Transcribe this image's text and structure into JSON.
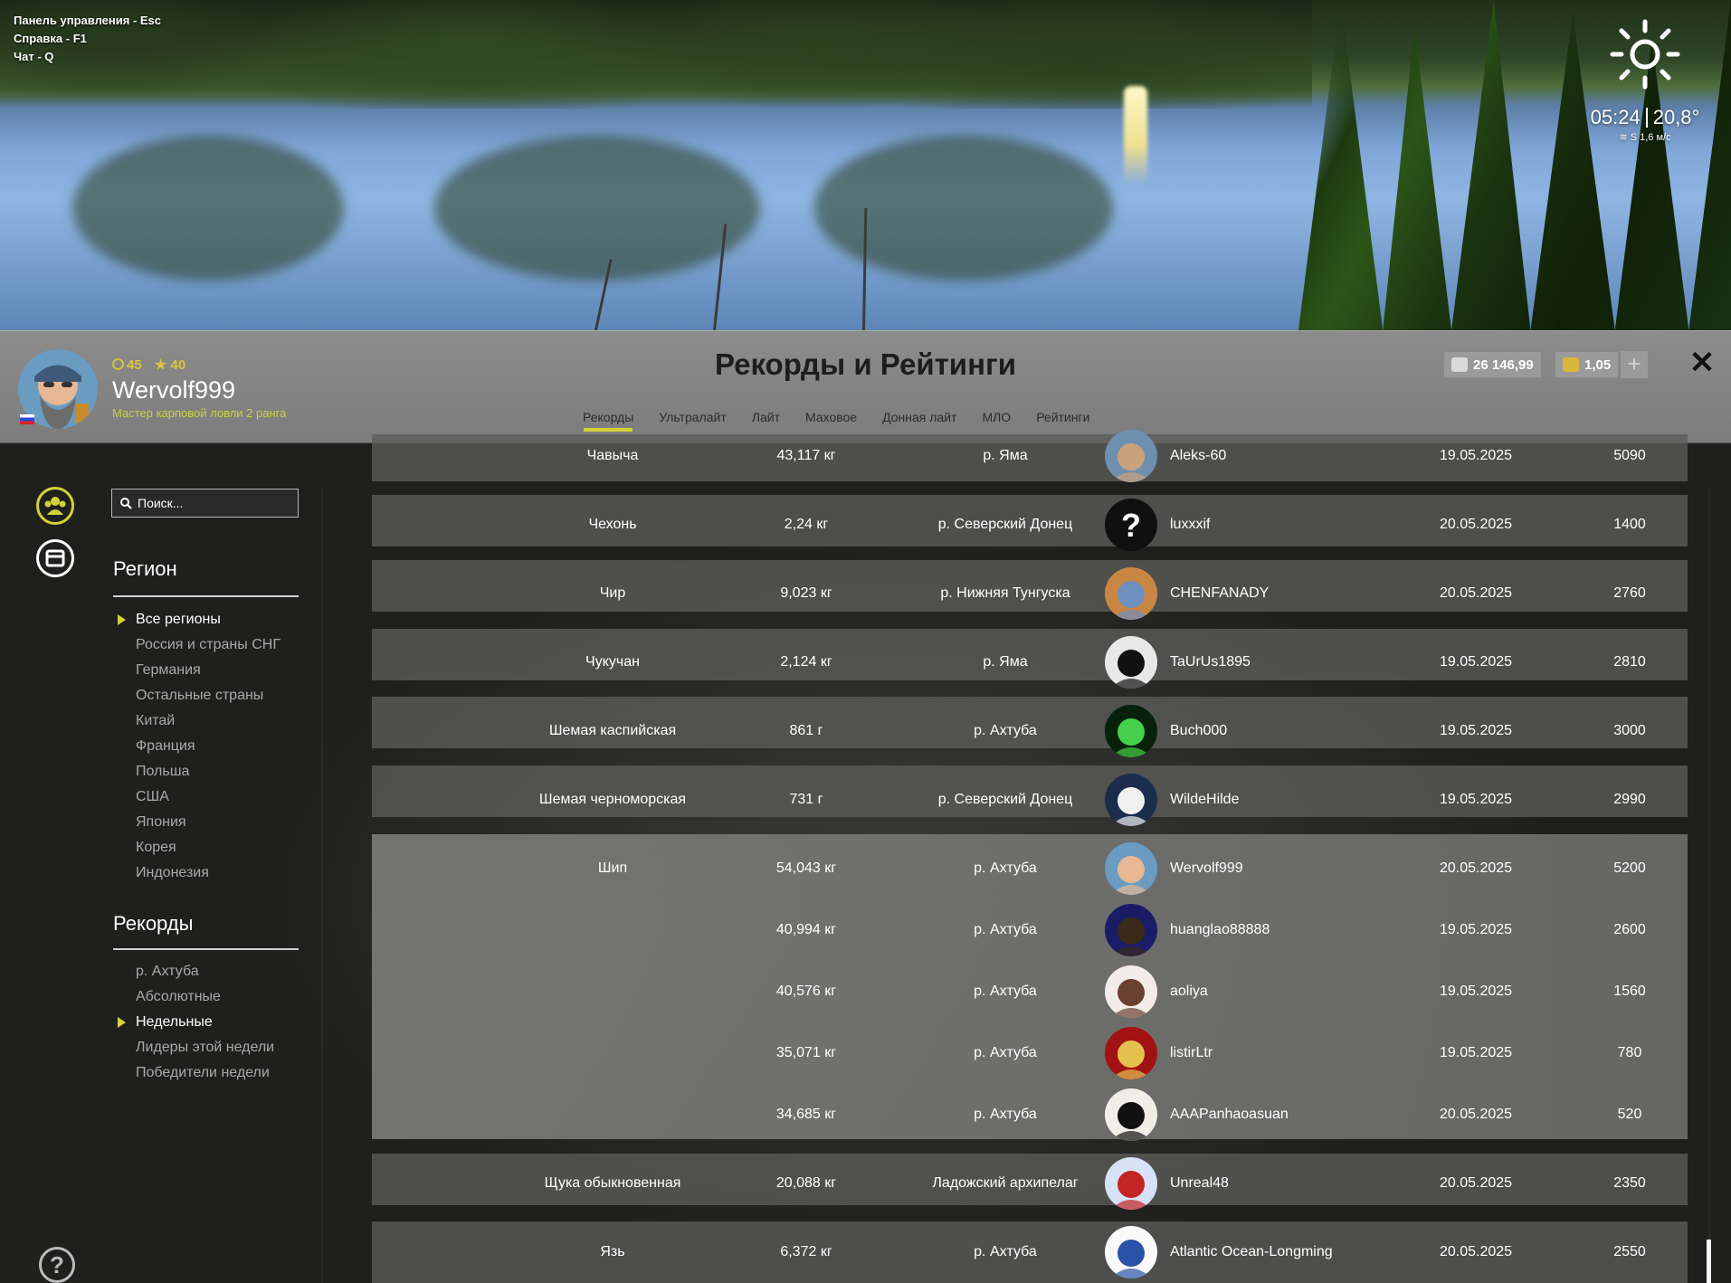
{
  "hints": [
    "Панель управления - Esc",
    "Справка - F1",
    "Чат - Q"
  ],
  "weather": {
    "time": "05:24",
    "temp": "20,8°",
    "wind": "S 1,6 м/с",
    "icon": "sun-icon"
  },
  "user": {
    "rank_coin": "45",
    "rank_star": "40",
    "name": "Wervolf999",
    "title": "Мастер карповой ловли 2 ранга"
  },
  "page_title": "Рекорды и Рейтинги",
  "tabs": [
    "Рекорды",
    "Ультралайт",
    "Лайт",
    "Маховое",
    "Донная лайт",
    "МЛО",
    "Рейтинги"
  ],
  "active_tab": "Рекорды",
  "currency": {
    "silver": "26 146,99",
    "gold": "1,05"
  },
  "search": {
    "placeholder": "Поиск..."
  },
  "region": {
    "heading": "Регион",
    "items": [
      "Все регионы",
      "Россия и страны СНГ",
      "Германия",
      "Остальные страны",
      "Китай",
      "Франция",
      "Польша",
      "США",
      "Япония",
      "Корея",
      "Индонезия"
    ],
    "selected": "Все регионы"
  },
  "records": {
    "heading": "Рекорды",
    "items": [
      "р. Ахтуба",
      "Абсолютные",
      "Недельные",
      "Лидеры этой недели",
      "Победители недели"
    ],
    "selected": "Недельные"
  },
  "rows": [
    {
      "fish": "Чавыча",
      "weight": "43,117 кг",
      "location": "р. Яма",
      "player": "Aleks-60",
      "date": "19.05.2025",
      "points": "5090"
    },
    {
      "fish": "Чехонь",
      "weight": "2,24 кг",
      "location": "р. Северский Донец",
      "player": "luxxxif",
      "date": "20.05.2025",
      "points": "1400"
    },
    {
      "fish": "Чир",
      "weight": "9,023 кг",
      "location": "р. Нижняя Тунгуска",
      "player": "CHENFANADY",
      "date": "20.05.2025",
      "points": "2760"
    },
    {
      "fish": "Чукучан",
      "weight": "2,124 кг",
      "location": "р. Яма",
      "player": "TaUrUs1895",
      "date": "19.05.2025",
      "points": "2810"
    },
    {
      "fish": "Шемая каспийская",
      "weight": "861 г",
      "location": "р. Ахтуба",
      "player": "Buch000",
      "date": "19.05.2025",
      "points": "3000"
    },
    {
      "fish": "Шемая черноморская",
      "weight": "731 г",
      "location": "р. Северский Донец",
      "player": "WildeHilde",
      "date": "19.05.2025",
      "points": "2990"
    },
    {
      "fish": "Шип",
      "weight": "54,043 кг",
      "location": "р. Ахтуба",
      "player": "Wervolf999",
      "date": "20.05.2025",
      "points": "5200"
    },
    {
      "fish": "",
      "weight": "40,994 кг",
      "location": "р. Ахтуба",
      "player": "huanglao88888",
      "date": "19.05.2025",
      "points": "2600"
    },
    {
      "fish": "",
      "weight": "40,576 кг",
      "location": "р. Ахтуба",
      "player": "aoliya",
      "date": "19.05.2025",
      "points": "1560"
    },
    {
      "fish": "",
      "weight": "35,071 кг",
      "location": "р. Ахтуба",
      "player": "listirLtr",
      "date": "19.05.2025",
      "points": "780"
    },
    {
      "fish": "",
      "weight": "34,685 кг",
      "location": "р. Ахтуба",
      "player": "AAAPanhaoasuan",
      "date": "20.05.2025",
      "points": "520"
    },
    {
      "fish": "Щука обыкновенная",
      "weight": "20,088 кг",
      "location": "Ладожский архипелаг",
      "player": "Unreal48",
      "date": "20.05.2025",
      "points": "2350"
    },
    {
      "fish": "Язь",
      "weight": "6,372 кг",
      "location": "р. Ахтуба",
      "player": "Atlantic Ocean-Longming",
      "date": "20.05.2025",
      "points": "2550"
    }
  ]
}
